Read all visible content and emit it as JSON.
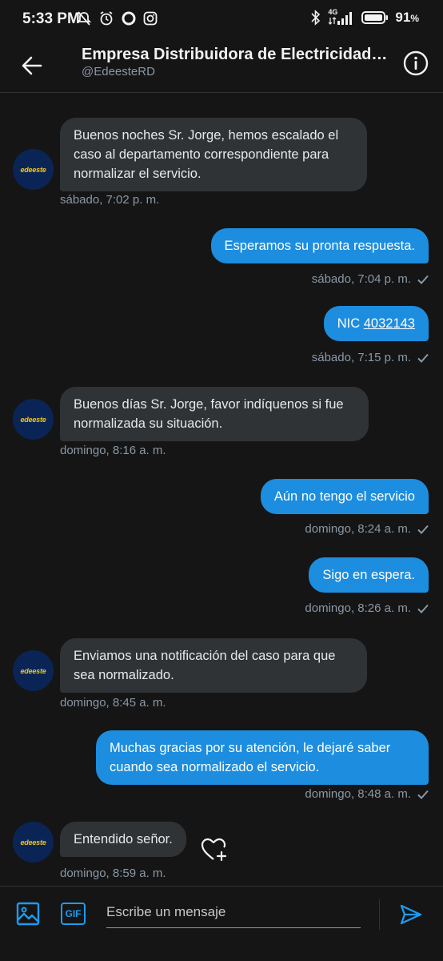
{
  "status_bar": {
    "time": "5:33 PM",
    "battery_percent": "91",
    "battery_unit": "%",
    "network": "4G",
    "icons_left": [
      "mute-icon",
      "alarm-icon",
      "circle-icon",
      "instagram-icon"
    ],
    "icons_right": [
      "bluetooth-icon",
      "signal-icon",
      "battery-icon"
    ]
  },
  "header": {
    "title": "Empresa Distribuidora de Electricidad…",
    "handle": "@EdeesteRD"
  },
  "avatar_label": "edeeste",
  "messages": [
    {
      "dir": "in",
      "text": "Buenos noches Sr. Jorge, hemos escalado el caso al departamento correspondiente para normalizar el servicio.",
      "time": "sábado, 7:02 p. m."
    },
    {
      "dir": "out",
      "text": "Esperamos su pronta respuesta.",
      "time": "sábado, 7:04 p. m."
    },
    {
      "dir": "out",
      "text_prefix": "NIC ",
      "link": "4032143",
      "time": "sábado, 7:15 p. m."
    },
    {
      "dir": "in",
      "text": "Buenos días Sr. Jorge, favor indíquenos si fue normalizada su situación.",
      "time": "domingo, 8:16 a. m."
    },
    {
      "dir": "out",
      "text": "Aún no tengo el servicio",
      "time": "domingo, 8:24 a. m."
    },
    {
      "dir": "out",
      "text": "Sigo en espera.",
      "time": "domingo, 8:26 a. m."
    },
    {
      "dir": "in",
      "text": "Enviamos una notificación del caso para que sea normalizado.",
      "time": "domingo, 8:45 a. m."
    },
    {
      "dir": "out",
      "text": "Muchas gracias por su atención, le dejaré saber cuando sea normalizado el servicio.",
      "time": "domingo, 8:48 a. m."
    },
    {
      "dir": "in",
      "text": "Entendido señor.",
      "time": "domingo, 8:59 a. m."
    }
  ],
  "composer": {
    "placeholder": "Escribe un mensaje",
    "gif_label": "GIF"
  },
  "colors": {
    "accent": "#1d9bf0",
    "outgoing_bubble": "#1d8ddf",
    "incoming_bubble": "#2f3336",
    "background": "#151515"
  }
}
